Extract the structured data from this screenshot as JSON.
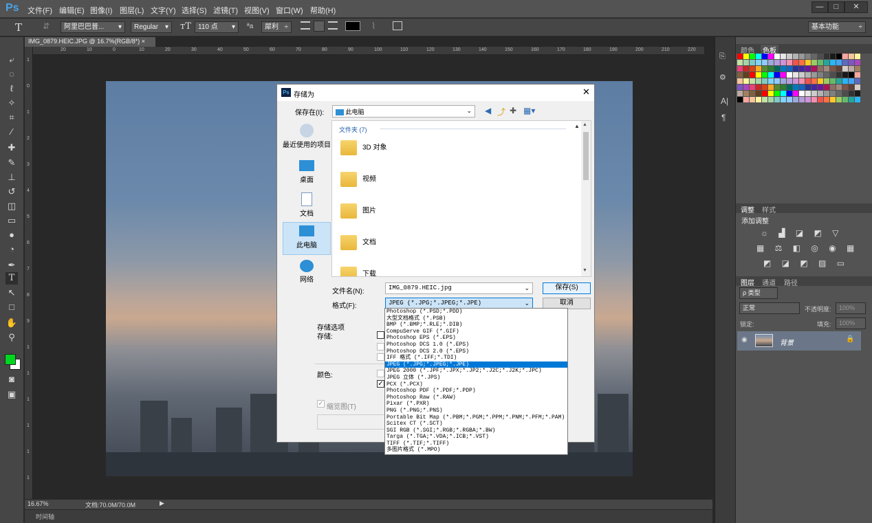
{
  "app": {
    "logo": "Ps"
  },
  "menus": [
    "文件(F)",
    "编辑(E)",
    "图像(I)",
    "图层(L)",
    "文字(Y)",
    "选择(S)",
    "滤镜(T)",
    "视图(V)",
    "窗口(W)",
    "帮助(H)"
  ],
  "window_buttons": [
    "—",
    "□",
    "✕"
  ],
  "options_bar": {
    "tool_icon": "T",
    "font_family": "阿里巴巴普...",
    "font_style": "Regular",
    "font_size": "110 点",
    "aa_label": "ªa",
    "aa_mode": "犀利",
    "workspace": "基本功能"
  },
  "document": {
    "tab_title": "IMG_0879.HEIC.JPG @ 16.7%(RGB/8*)",
    "close": "×",
    "ruler_h": [
      "20",
      "10",
      "0",
      "10",
      "20",
      "30",
      "40",
      "50",
      "60",
      "70",
      "80",
      "90",
      "100",
      "110",
      "120",
      "130",
      "140",
      "150",
      "160",
      "170",
      "180",
      "190",
      "200",
      "210",
      "220"
    ],
    "ruler_v": [
      "1",
      "0",
      "1",
      "2",
      "3",
      "4",
      "5",
      "6",
      "7",
      "8",
      "9",
      "1",
      "1",
      "1",
      "1",
      "1",
      "1"
    ]
  },
  "status": {
    "zoom": "16.67%",
    "doc": "文档:70.0M/70.0M"
  },
  "timeline": {
    "label": "时间轴"
  },
  "panels": {
    "color_tabs": [
      "颜色",
      "色板"
    ],
    "adjust_tabs": [
      "调整",
      "样式"
    ],
    "adjust_title": "添加调整",
    "layer_tabs": [
      "图层",
      "通道",
      "路径"
    ],
    "layer_filter": "ρ 类型",
    "blend_mode": "正常",
    "opacity_label": "不透明度:",
    "opacity": "100%",
    "lock_label": "锁定:",
    "fill_label": "填充:",
    "fill": "100%",
    "layer_name": "背景"
  },
  "dialog": {
    "title": "存储为",
    "save_in_label": "保存在(I):",
    "save_in_value": "此电脑",
    "places": [
      "最近使用的项目",
      "桌面",
      "文档",
      "此电脑",
      "网络"
    ],
    "group_header": "文件夹 (7)",
    "folders": [
      "3D 对象",
      "视频",
      "图片",
      "文档",
      "下载"
    ],
    "filename_label": "文件名(N):",
    "filename_value": "IMG_0879.HEIC.jpg",
    "format_label": "格式(F):",
    "format_value": "JPEG (*.JPG;*.JPEG;*.JPE)",
    "save_button": "保存(S)",
    "cancel_button": "取消",
    "save_options": "存储选项",
    "save_label": "存储:",
    "color_label": "颜色:",
    "thumbnail": "缩览图(T)"
  },
  "format_options": [
    "Photoshop (*.PSD;*.PDD)",
    "大型文档格式 (*.PSB)",
    "BMP (*.BMP;*.RLE;*.DIB)",
    "CompuServe GIF (*.GIF)",
    "Photoshop EPS (*.EPS)",
    "Photoshop DCS 1.0 (*.EPS)",
    "Photoshop DCS 2.0 (*.EPS)",
    "IFF 格式 (*.IFF;*.TDI)",
    "JPEG (*.JPG;*.JPEG;*.JPE)",
    "JPEG 2000 (*.JPF;*.JPX;*.JP2;*.J2C;*.J2K;*.JPC)",
    "JPEG 立体 (*.JPS)",
    "PCX (*.PCX)",
    "Photoshop PDF (*.PDF;*.PDP)",
    "Photoshop Raw (*.RAW)",
    "Pixar (*.PXR)",
    "PNG (*.PNG;*.PNS)",
    "Portable Bit Map (*.PBM;*.PGM;*.PPM;*.PNM;*.PFM;*.PAM)",
    "Scitex CT (*.SCT)",
    "SGI RGB (*.SGI;*.RGB;*.RGBA;*.BW)",
    "Targa (*.TGA;*.VDA;*.ICB;*.VST)",
    "TIFF (*.TIF;*.TIFF)",
    "多图片格式 (*.MPO)"
  ],
  "selected_format_index": 8,
  "colors": {
    "accent": "#0078d7",
    "foreground_swatch": "#00d61f",
    "background_swatch": "#ffffff"
  }
}
